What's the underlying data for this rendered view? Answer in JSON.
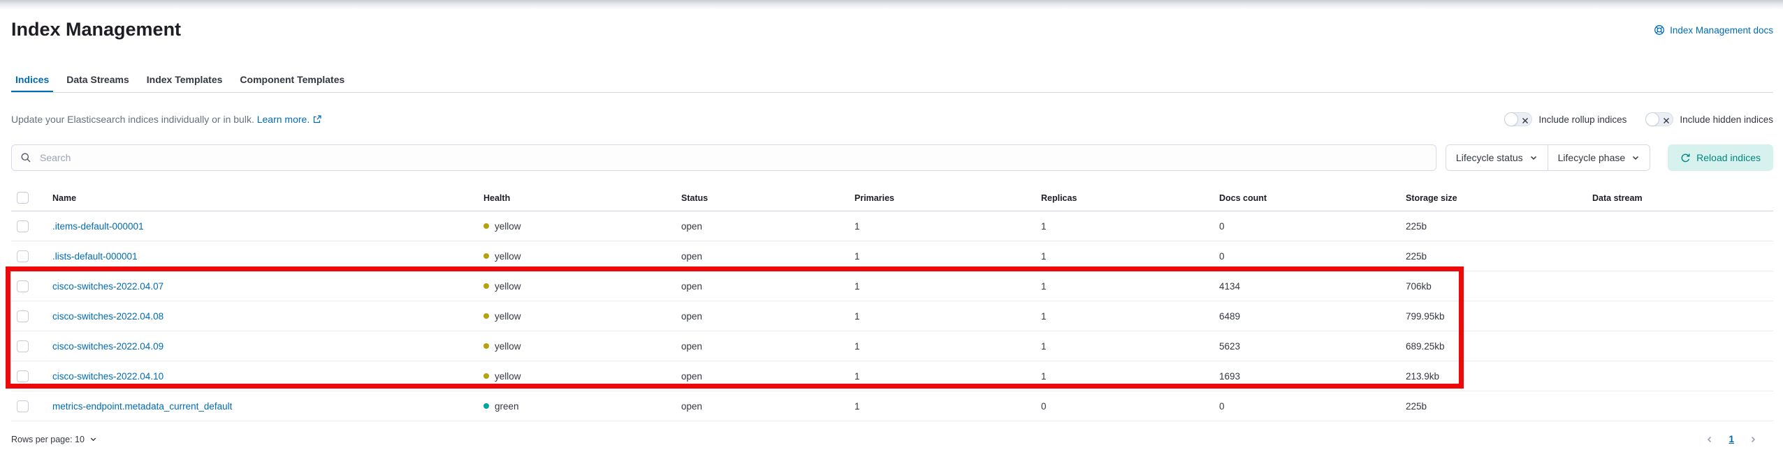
{
  "page_title": "Index Management",
  "header": {
    "docs_link_label": "Index Management docs"
  },
  "tabs": [
    {
      "label": "Indices",
      "active": true
    },
    {
      "label": "Data Streams",
      "active": false
    },
    {
      "label": "Index Templates",
      "active": false
    },
    {
      "label": "Component Templates",
      "active": false
    }
  ],
  "description": {
    "text": "Update your Elasticsearch indices individually or in bulk.",
    "link_label": "Learn more."
  },
  "toggles": [
    {
      "label": "Include rollup indices",
      "state": "off"
    },
    {
      "label": "Include hidden indices",
      "state": "off"
    }
  ],
  "search": {
    "placeholder": "Search",
    "value": ""
  },
  "filters": [
    {
      "label": "Lifecycle status"
    },
    {
      "label": "Lifecycle phase"
    }
  ],
  "reload_button_label": "Reload indices",
  "table": {
    "columns": [
      "Name",
      "Health",
      "Status",
      "Primaries",
      "Replicas",
      "Docs count",
      "Storage size",
      "Data stream"
    ],
    "rows": [
      {
        "name": ".items-default-000001",
        "health": "yellow",
        "status": "open",
        "primaries": "1",
        "replicas": "1",
        "docs_count": "0",
        "storage_size": "225b",
        "data_stream": ""
      },
      {
        "name": ".lists-default-000001",
        "health": "yellow",
        "status": "open",
        "primaries": "1",
        "replicas": "1",
        "docs_count": "0",
        "storage_size": "225b",
        "data_stream": ""
      },
      {
        "name": "cisco-switches-2022.04.07",
        "health": "yellow",
        "status": "open",
        "primaries": "1",
        "replicas": "1",
        "docs_count": "4134",
        "storage_size": "706kb",
        "data_stream": ""
      },
      {
        "name": "cisco-switches-2022.04.08",
        "health": "yellow",
        "status": "open",
        "primaries": "1",
        "replicas": "1",
        "docs_count": "6489",
        "storage_size": "799.95kb",
        "data_stream": ""
      },
      {
        "name": "cisco-switches-2022.04.09",
        "health": "yellow",
        "status": "open",
        "primaries": "1",
        "replicas": "1",
        "docs_count": "5623",
        "storage_size": "689.25kb",
        "data_stream": ""
      },
      {
        "name": "cisco-switches-2022.04.10",
        "health": "yellow",
        "status": "open",
        "primaries": "1",
        "replicas": "1",
        "docs_count": "1693",
        "storage_size": "213.9kb",
        "data_stream": ""
      },
      {
        "name": "metrics-endpoint.metadata_current_default",
        "health": "green",
        "status": "open",
        "primaries": "1",
        "replicas": "0",
        "docs_count": "0",
        "storage_size": "225b",
        "data_stream": ""
      }
    ],
    "highlighted_row_indexes": [
      2,
      3,
      4,
      5
    ]
  },
  "pagination": {
    "rows_per_page_label": "Rows per page: 10",
    "current_page": "1"
  },
  "icons": {
    "docs": "help-icon",
    "learn_more": "external-link-icon",
    "toggle_off": "cross-icon",
    "search": "search-icon",
    "filter_dropdown": "chevron-down-icon",
    "reload": "refresh-icon",
    "pager_prev": "chevron-left-icon",
    "pager_next": "chevron-right-icon"
  },
  "colors": {
    "link_blue": "#006BB4",
    "health_yellow": "#B5A10B",
    "health_green": "#00A69B",
    "reload_teal_text": "#00857C",
    "reload_teal_bg": "#D7F1EE",
    "border_gray": "#D3DAE6",
    "annotation_red": "#EE0807"
  }
}
